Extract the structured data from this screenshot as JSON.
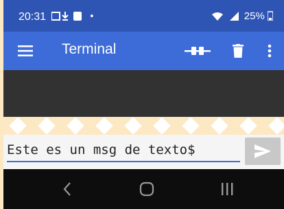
{
  "status_bar": {
    "time": "20:31",
    "dot": "•",
    "battery": "25%"
  },
  "app_bar": {
    "title": "Terminal"
  },
  "input": {
    "value": "Este es un msg de texto$"
  },
  "colors": {
    "app_bar": "#3d6bd7",
    "status_bar": "#2f55b4",
    "terminal": "#323232",
    "send": "#c8c8c8"
  },
  "icons": [
    "menu-icon",
    "connect-icon",
    "trash-icon",
    "more-vert-icon",
    "send-icon",
    "back-icon",
    "home-icon",
    "recents-icon"
  ]
}
